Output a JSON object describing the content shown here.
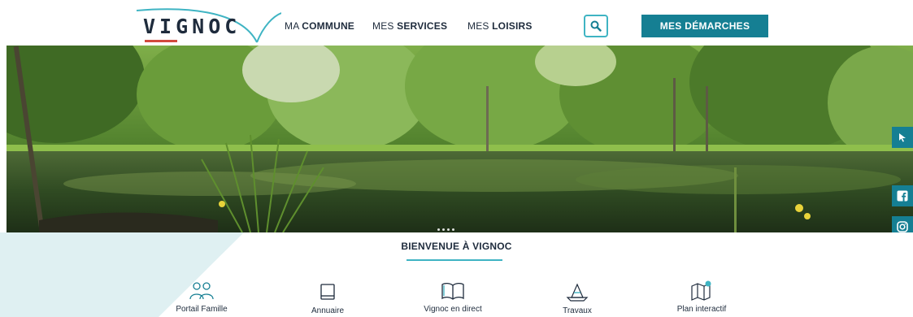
{
  "header": {
    "logo_text": "VIGNOC",
    "nav": [
      {
        "pre": "MA ",
        "strong": "COMMUNE"
      },
      {
        "pre": "MES ",
        "strong": "SERVICES"
      },
      {
        "pre": "MES ",
        "strong": "LOISIRS"
      }
    ],
    "cta_label": "MES DÉMARCHES",
    "search_icon": "search-icon"
  },
  "hero": {
    "alt_scene": "pond-forest-photo",
    "social": [
      "share-icon",
      "facebook-icon",
      "instagram-icon"
    ],
    "carousel_dots": 4
  },
  "welcome": {
    "title": "BIENVENUE À VIGNOC",
    "links": [
      {
        "label": "Portail Famille",
        "icon": "family-icon"
      },
      {
        "label": "Annuaire",
        "icon": "book-icon"
      },
      {
        "label": "Vignoc en direct",
        "icon": "open-book-icon"
      },
      {
        "label": "Travaux",
        "icon": "cone-icon"
      },
      {
        "label": "Plan interactif",
        "icon": "map-icon"
      }
    ]
  },
  "colors": {
    "brand_teal": "#157f93",
    "accent_cyan": "#3fb4c3",
    "logo_red": "#d24a3e",
    "text_dark": "#1e2b3c"
  }
}
